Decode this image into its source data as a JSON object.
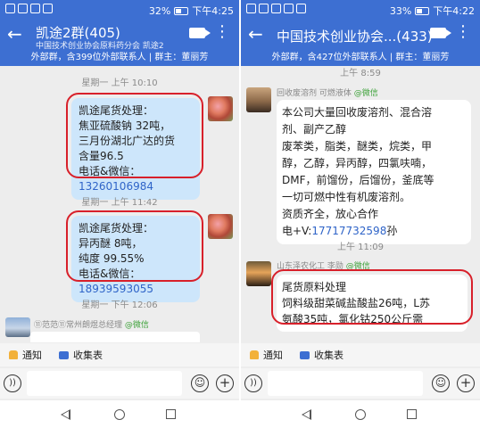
{
  "left": {
    "status": {
      "battery": "32%",
      "time": "下午4:25"
    },
    "header": {
      "title": "凯途2群(405)",
      "subtitle": "中国技术创业协会原料药分会 凯途2",
      "info": "外部群，含399位外部联系人 | 群主：董丽芳"
    },
    "messages": [
      {
        "time": "星期一 上午 10:10",
        "lines": [
          "凯途尾货处理：",
          "焦亚硫酸钠 32吨，",
          "三月份湖北广达的货",
          "含量96.5"
        ],
        "contact_label": "电话&微信：",
        "phone": "13260106984"
      },
      {
        "time": "星期一 上午 11:42",
        "lines": [
          "凯途尾货处理：",
          "异丙醚 8吨，",
          "纯度 99.55%"
        ],
        "contact_label": "电话&微信：",
        "phone": "18939593055"
      }
    ],
    "last_time": "星期一 下午 12:06",
    "last_sender": "⑪范范⑪常州朗煜总经理",
    "last_sender_tag": "@微信"
  },
  "right": {
    "status": {
      "battery": "33%",
      "time": "下午4:22"
    },
    "header": {
      "title": "中国技术创业协会...(433)",
      "info": "外部群，含427位外部联系人 | 群主：董丽芳"
    },
    "top_time": "上午 8:59",
    "msg1": {
      "sender": "回收废溶剂 可燃液体",
      "sender_tag": "@微信",
      "lines": [
        "本公司大量回收废溶剂、混合溶",
        "剂、副产乙醇",
        "废苯类，脂类，醚类，烷类，甲",
        "醇，乙醇，异丙醇，四氯呋喃，",
        "DMF，前馏份，后馏份，釜底等",
        "一切可燃中性有机废溶剂。",
        "资质齐全，放心合作"
      ],
      "contact_prefix": "电+V:",
      "phone": "17717732598",
      "suffix": "孙"
    },
    "mid_time": "上午 11:09",
    "msg2": {
      "sender": "山东泽农化工 李勋",
      "sender_tag": "@微信",
      "lines": [
        "尾货原料处理",
        "饲料级甜菜碱盐酸盐26吨，L苏",
        "氨酸35吨，氯化钴250公斤需"
      ]
    }
  },
  "toolbar": {
    "notice": "通知",
    "collect": "收集表"
  }
}
